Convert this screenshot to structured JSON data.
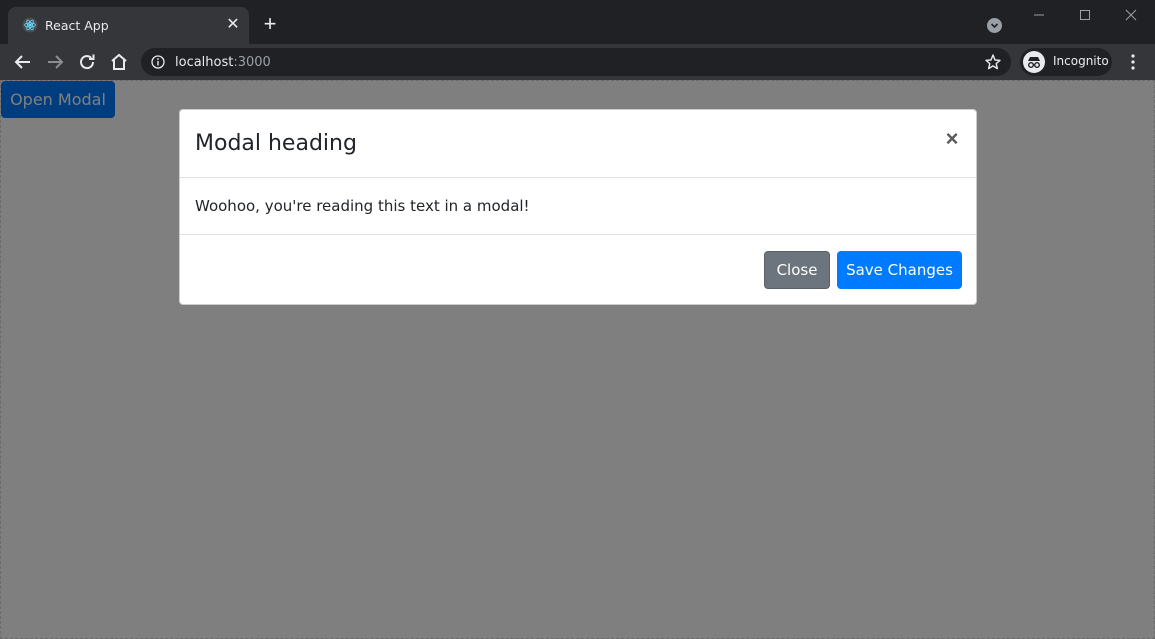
{
  "browser": {
    "tab": {
      "title": "React App",
      "close_glyph": "✕",
      "favicon": "react-logo-icon"
    },
    "new_tab_glyph": "+",
    "address": {
      "host": "localhost",
      "port": ":3000"
    },
    "profile": {
      "label": "Incognito"
    }
  },
  "page": {
    "open_modal_label": "Open Modal"
  },
  "modal": {
    "title": "Modal heading",
    "close_glyph": "×",
    "body_text": "Woohoo, you're reading this text in a modal!",
    "close_label": "Close",
    "save_label": "Save Changes"
  },
  "colors": {
    "primary": "#007bff",
    "secondary": "#6c757d",
    "chrome_dark": "#202124",
    "chrome_toolbar": "#35363a"
  }
}
